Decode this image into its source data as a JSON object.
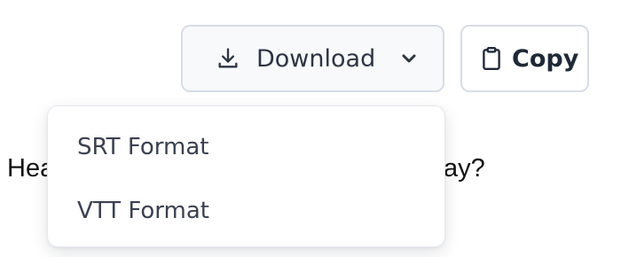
{
  "toolbar": {
    "download_label": "Download",
    "copy_label": "Copy",
    "download_icon": "download-icon",
    "chevron_icon": "chevron-down-icon",
    "copy_icon": "clipboard-icon"
  },
  "background_text": {
    "left_fragment": "Hea",
    "right_fragment": "ay?"
  },
  "download_menu": {
    "items": [
      {
        "label": "SRT Format"
      },
      {
        "label": "VTT Format"
      }
    ]
  },
  "colors": {
    "button_border": "#d7dde5",
    "button_text": "#2d3543",
    "menu_text": "#3a4150"
  }
}
